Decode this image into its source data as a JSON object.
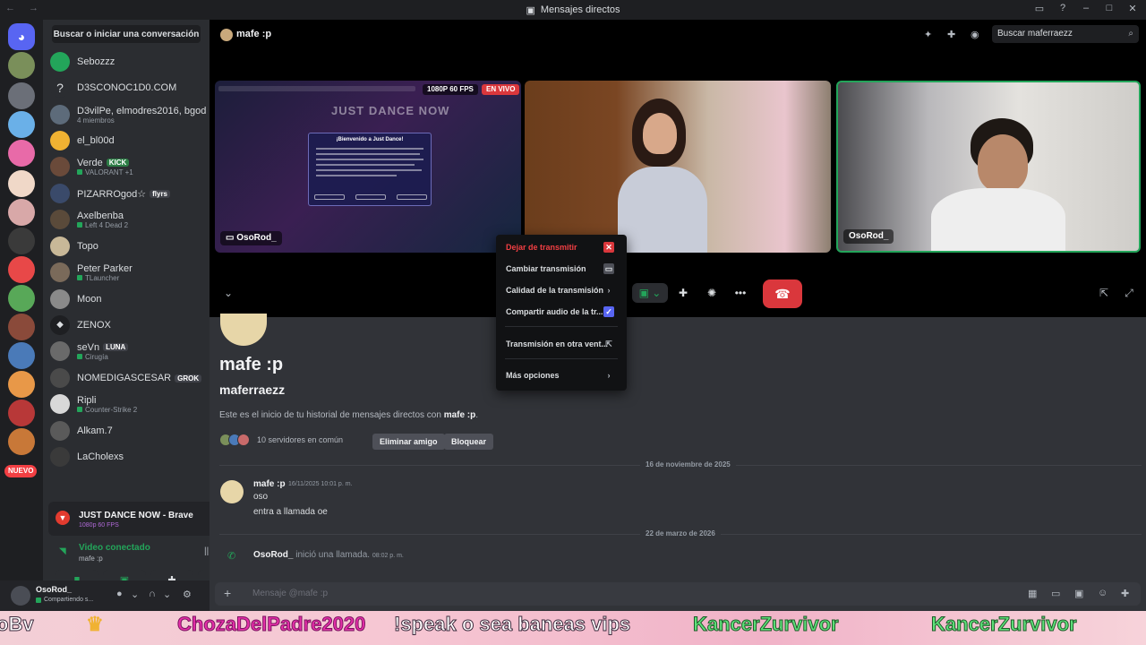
{
  "window": {
    "title": "Mensajes directos",
    "nav": "←  →"
  },
  "dm_list": {
    "search_label": "Buscar o iniciar una conversación",
    "items": [
      {
        "name": "Sebozzz",
        "sub": "",
        "badge": ""
      },
      {
        "name": "D3SCONOC1D0.COM",
        "sub": "",
        "badge": ""
      },
      {
        "name": "D3vilPe, elmodres2016, bgod",
        "sub": "4 miembros",
        "badge": ""
      },
      {
        "name": "el_bl00d",
        "sub": "",
        "badge": ""
      },
      {
        "name": "Verde",
        "sub": "VALORANT +1",
        "badge": "KICK"
      },
      {
        "name": "PIZARROgod☆",
        "sub": "",
        "badge": "flyrs"
      },
      {
        "name": "Axelbenba",
        "sub": "Left 4 Dead 2",
        "badge": ""
      },
      {
        "name": "Topo",
        "sub": "",
        "badge": ""
      },
      {
        "name": "Peter Parker",
        "sub": "TLauncher",
        "badge": ""
      },
      {
        "name": "Moon",
        "sub": "",
        "badge": ""
      },
      {
        "name": "ZENOX",
        "sub": "",
        "badge": ""
      },
      {
        "name": "seVn",
        "sub": "Cirugía",
        "badge": "LUNA"
      },
      {
        "name": "NOMEDIGASCESAR",
        "sub": "",
        "badge": "GROK"
      },
      {
        "name": "Ripli",
        "sub": "Counter-Strike 2",
        "badge": ""
      },
      {
        "name": "Alkam.7",
        "sub": "",
        "badge": ""
      },
      {
        "name": "LaCholexs",
        "sub": "",
        "badge": ""
      }
    ],
    "nuevo_label": "NUEVO"
  },
  "stream_card": {
    "title": "JUST DANCE NOW - Brave",
    "quality": "1080p 60 FPS"
  },
  "voice": {
    "status": "Video conectado",
    "channel": "mafe :p"
  },
  "user": {
    "name": "OsoRod_",
    "status": "Compartiendo s..."
  },
  "call_header": {
    "title": "mafe :p",
    "search_placeholder": "Buscar maferraezz"
  },
  "tiles": {
    "screen": {
      "label": "OsoRod_",
      "quality": "1080P 60 FPS",
      "live": "EN VIVO",
      "game_title": "JUST DANCE NOW",
      "dialog_title": "¡Bienvenido a Just Dance!"
    },
    "cam2": {
      "label": "OsoRod_"
    }
  },
  "context_menu": {
    "items": [
      {
        "label": "Dejar de transmitir"
      },
      {
        "label": "Cambiar transmisión"
      },
      {
        "label": "Calidad de la transmisión"
      },
      {
        "label": "Compartir audio de la tr..."
      },
      {
        "label": "Transmisión en otra vent..."
      },
      {
        "label": "Más opciones"
      }
    ]
  },
  "profile": {
    "display_name": "mafe :p",
    "username": "maferraezz",
    "intro_prefix": "Este es el inicio de tu historial de mensajes directos con ",
    "intro_name": "mafe :p",
    "intro_suffix": ".",
    "mutual_servers": "10 servidores en común",
    "remove_friend": "Eliminar amigo",
    "block": "Bloquear"
  },
  "messages": {
    "date1": "16 de noviembre de 2025",
    "author": "mafe :p",
    "time": "16/11/2025 10:01 p. m.",
    "line1": "oso",
    "line2": "entra a llamada oe",
    "date2": "22 de marzo de 2026",
    "call_author": "OsoRod_",
    "call_text": " inició una llamada. ",
    "call_time": "08:02 p. m."
  },
  "composer": {
    "placeholder": "Mensaje @mafe :p"
  },
  "overlay": {
    "t1": "oBv",
    "t2": "ChozaDelPadre2020",
    "t3": "!speak o sea baneas vips",
    "t4": "KancerZurvivor",
    "t5": "KancerZurvivor"
  },
  "colors": {
    "accent": "#5865f2",
    "online": "#23a55a",
    "danger": "#da373c"
  }
}
